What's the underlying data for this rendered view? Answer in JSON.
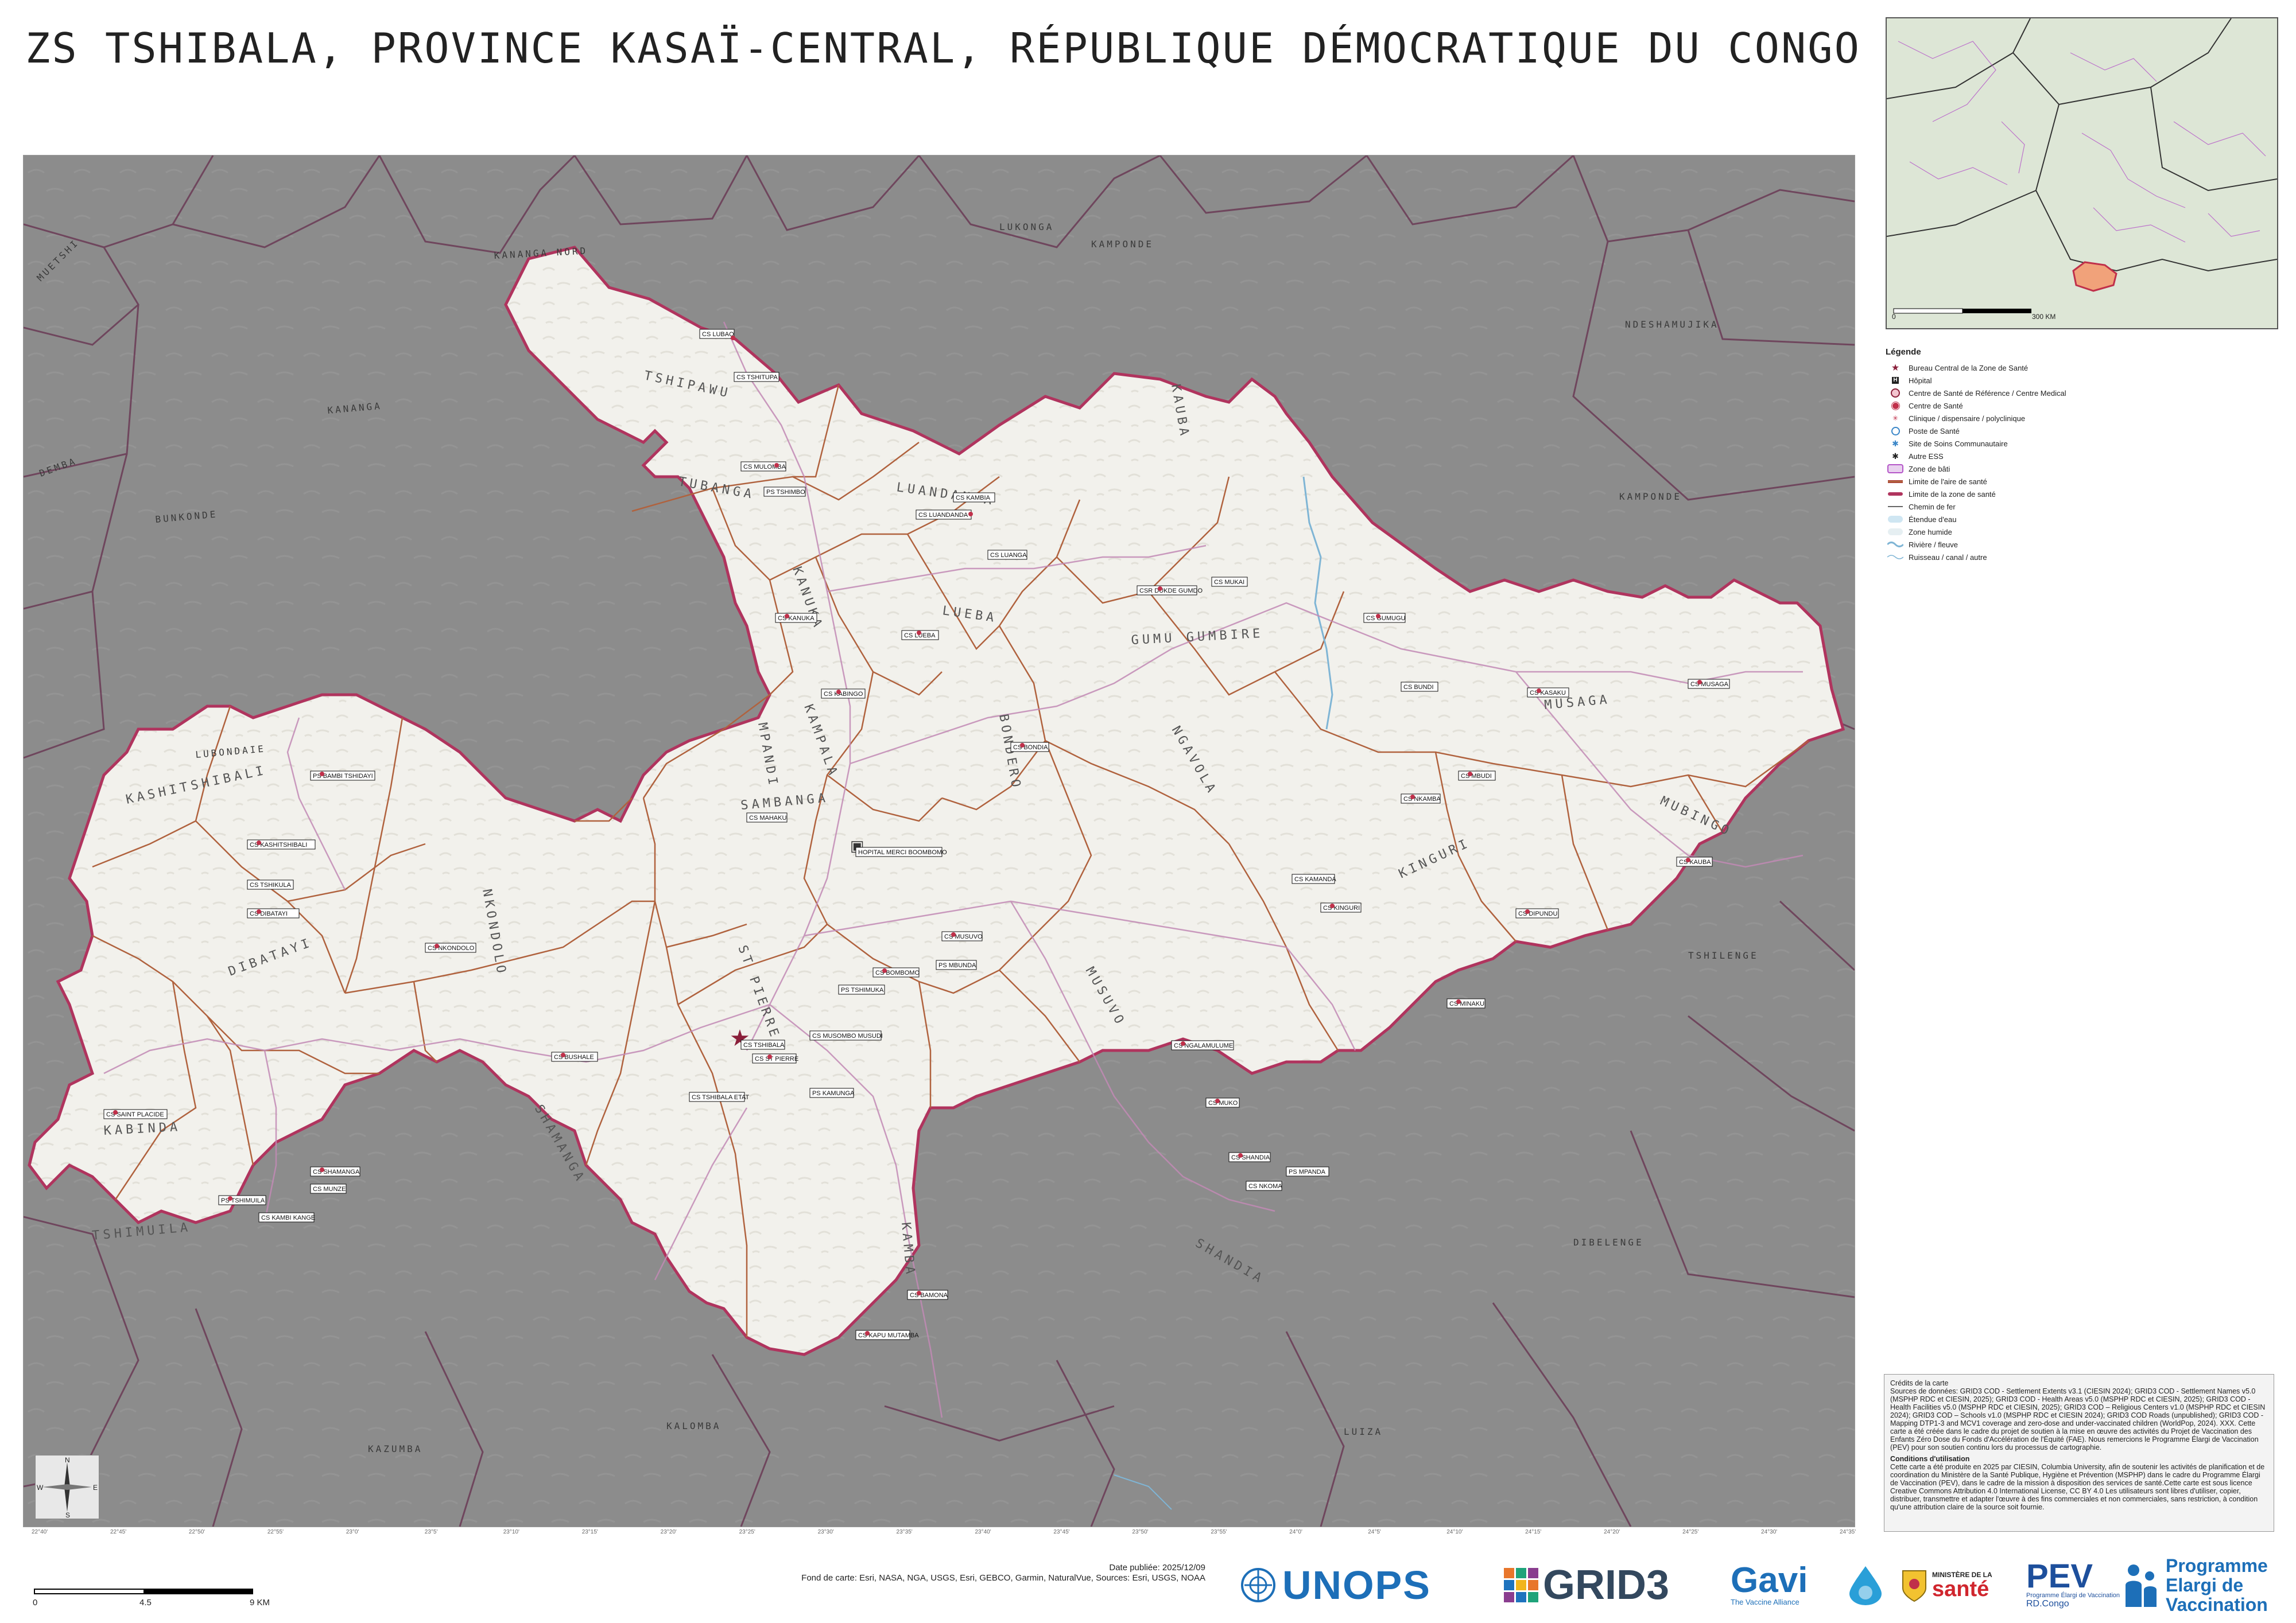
{
  "title": "ZS TSHIBALA, PROVINCE KASAÏ-CENTRAL, RÉPUBLIQUE DÉMOCRATIQUE DU CONGO",
  "map": {
    "colors": {
      "background": "#8a8a8a",
      "zone": "#f4f3ef",
      "zone_border": "#b0345e",
      "area_border": "#b0623e",
      "outside_border": "#6a3a55"
    },
    "health_areas": [
      "TSHIPAWU",
      "TUBANGA",
      "LUANDANDA",
      "KANUKA",
      "LUEBA",
      "KAMPALA",
      "BONDERO",
      "GUMU GUMBIRE",
      "MUSAGA",
      "NGAVOLA",
      "KASHITSHIBALI",
      "SAMBANGA",
      "MPANDI",
      "DIBATAYI",
      "ST PIERRE",
      "SHAMANGA",
      "NKONDOLO",
      "MUSUVO",
      "KINGURI",
      "KAMBA",
      "MUBINGO",
      "SHANDIA",
      "TSHIMUILA",
      "KABINDA",
      "KAUBA"
    ],
    "facilities": [
      "CS LUBAO",
      "CS TSHITUPA",
      "CS MULOMBA",
      "PS TSHIMBO",
      "CS LUANDANDA",
      "CS KAMBIA",
      "CS KANUKA",
      "CS LUEBA",
      "CS LUANGA",
      "CS KABINGO",
      "CS BONDIA",
      "CSR DUKDE GUMDO",
      "CS MUKAI",
      "CS GUMUGU",
      "CS MUSAGA",
      "CS KASAKU",
      "CS BUNDI",
      "CS MINAKU",
      "CS NKAMBA",
      "CS MBUDI",
      "PS BAMBI TSHIDAYI",
      "CS KASHITSHIBALI",
      "CS DIBATAYI",
      "CS TSHIKULA",
      "CS NKONDOLO",
      "HOPITAL MERCI BOOMBOMO",
      "CS MAHAKU",
      "CS MUSUVO",
      "PS MBUNDA",
      "CS KINGURI",
      "CS KAMANDA",
      "CS DIPUNDU",
      "CS KAUBA",
      "CS BOMBOMO",
      "PS TSHIMUKA",
      "CS ST PIERRE",
      "CS MUSOMBO MUSUDI",
      "CS TSHIBALA",
      "PS KAMUNGA",
      "CS TSHIBALA ETAT",
      "CS NGALAMULUME",
      "CS MUKO",
      "CS BUSHALE",
      "CS SAINT PLACIDE",
      "PS TSHIMUILA",
      "CS KAMBI KANGE",
      "CS SHAMANGA",
      "CS MUNZE",
      "CS SHANDIA",
      "CS BAMONA",
      "CS KAPU MUTAMBA",
      "PS MPANDA",
      "CS NKOMA"
    ],
    "compass": {
      "n": "N",
      "s": "S",
      "e": "E",
      "w": "W"
    },
    "coords_bottom": [
      "22°40'",
      "22°45'",
      "22°50'",
      "22°55'",
      "23°0'",
      "23°5'",
      "23°10'",
      "23°15'",
      "23°20'",
      "23°25'",
      "23°30'",
      "23°35'",
      "23°40'",
      "23°45'",
      "23°50'",
      "23°55'",
      "24°0'",
      "24°5'",
      "24°10'",
      "24°15'",
      "24°20'",
      "24°25'",
      "24°30'",
      "24°35'"
    ]
  },
  "inset": {
    "scale_start": "0",
    "scale_end": "300 KM"
  },
  "legend": {
    "title": "Légende",
    "items": [
      {
        "label": "Bureau Central de la Zone de Santé",
        "symbol": "bcz"
      },
      {
        "label": "Hôpital",
        "symbol": "hospital"
      },
      {
        "label": "Centre de Santé de Référence / Centre Medical",
        "symbol": "csr"
      },
      {
        "label": "Centre de Santé",
        "symbol": "cs"
      },
      {
        "label": "Clinique / dispensaire / polyclinique",
        "symbol": "clinic"
      },
      {
        "label": "Poste de Santé",
        "symbol": "ps"
      },
      {
        "label": "Site de Soins Communautaire",
        "symbol": "ssc"
      },
      {
        "label": "Autre ESS",
        "symbol": "other"
      },
      {
        "label": "Zone de bâti",
        "symbol": "built"
      },
      {
        "label": "Limite de l'aire de santé",
        "symbol": "area-limit"
      },
      {
        "label": "Limite de la zone de santé",
        "symbol": "zone-limit"
      },
      {
        "label": "Chemin de fer",
        "symbol": "rail"
      },
      {
        "label": "Étendue d'eau",
        "symbol": "water"
      },
      {
        "label": "Zone humide",
        "symbol": "wetland"
      },
      {
        "label": "Rivière / fleuve",
        "symbol": "river"
      },
      {
        "label": "Ruisseau / canal / autre",
        "symbol": "stream"
      }
    ]
  },
  "credits": {
    "title": "Crédits de la carte",
    "sources": "Sources de données: GRID3 COD - Settlement Extents v3.1 (CIESIN 2024); GRID3 COD - Settlement Names v5.0 (MSPHP RDC et CIESIN, 2025); GRID3 COD - Health Areas v5.0 (MSPHP RDC et CIESIN, 2025); GRID3 COD - Health Facilities v5.0 (MSPHP RDC et CIESIN, 2025); GRID3 COD – Religious Centers v1.0 (MSPHP RDC et CIESIN 2024); GRID3 COD – Schools v1.0 (MSPHP RDC et CIESIN 2024); GRID3 COD Roads (unpublished); GRID3 COD - Mapping DTP1-3 and MCV1 coverage and zero-dose and under-vaccinated children (WorldPop, 2024). XXX. Cette carte a été créée dans le cadre du projet de soutien à la mise en œuvre des activités du Projet de Vaccination des Enfants Zéro Dose du Fonds d'Accélération de l'Équité (FAE). Nous remercions le Programme Élargi de Vaccination (PEV) pour son soutien continu lors du processus de cartographie.",
    "conditions_title": "Conditions d'utilisation",
    "conditions": "Cette carte a été produite en 2025 par CIESIN, Columbia University, afin de soutenir les activités de planification et de coordination du Ministère de la Santé Publique, Hygiène et Prévention (MSPHP) dans le cadre du Programme Élargi de Vaccination (PEV), dans le cadre de la mission à disposition des services de santé.Cette carte est sous licence Creative Commons Attribution 4.0 International License, CC BY 4.0 Les utilisateurs sont libres d'utiliser, copier, distribuer, transmettre et adapter l'œuvre à des fins commerciales et non commerciales, sans restriction, à condition qu'une attribution claire de la source soit fournie."
  },
  "scalebar": {
    "start": "0",
    "mid": "4.5",
    "end": "9 KM"
  },
  "footer": {
    "date": "Date publiée: 2025/12/09",
    "basemap": "Fond de carte: Esri, NASA, NGA, USGS, Esri, GEBCO, Garmin, NaturalVue, Sources: Esri, USGS, NOAA"
  },
  "logos": {
    "unops": "UNOPS",
    "grid3": "GRID3",
    "gavi": "Gavi",
    "gavi_sub": "The Vaccine Alliance",
    "ministere_top": "MINISTÈRE DE LA",
    "ministere": "santé",
    "pev": "PEV",
    "pev_sub": "Programme Élargi de Vaccination",
    "pev_rdc": "RD.Congo",
    "programme_line1": "Programme",
    "programme_line2": "Elargi de",
    "programme_line3": "Vaccination"
  }
}
